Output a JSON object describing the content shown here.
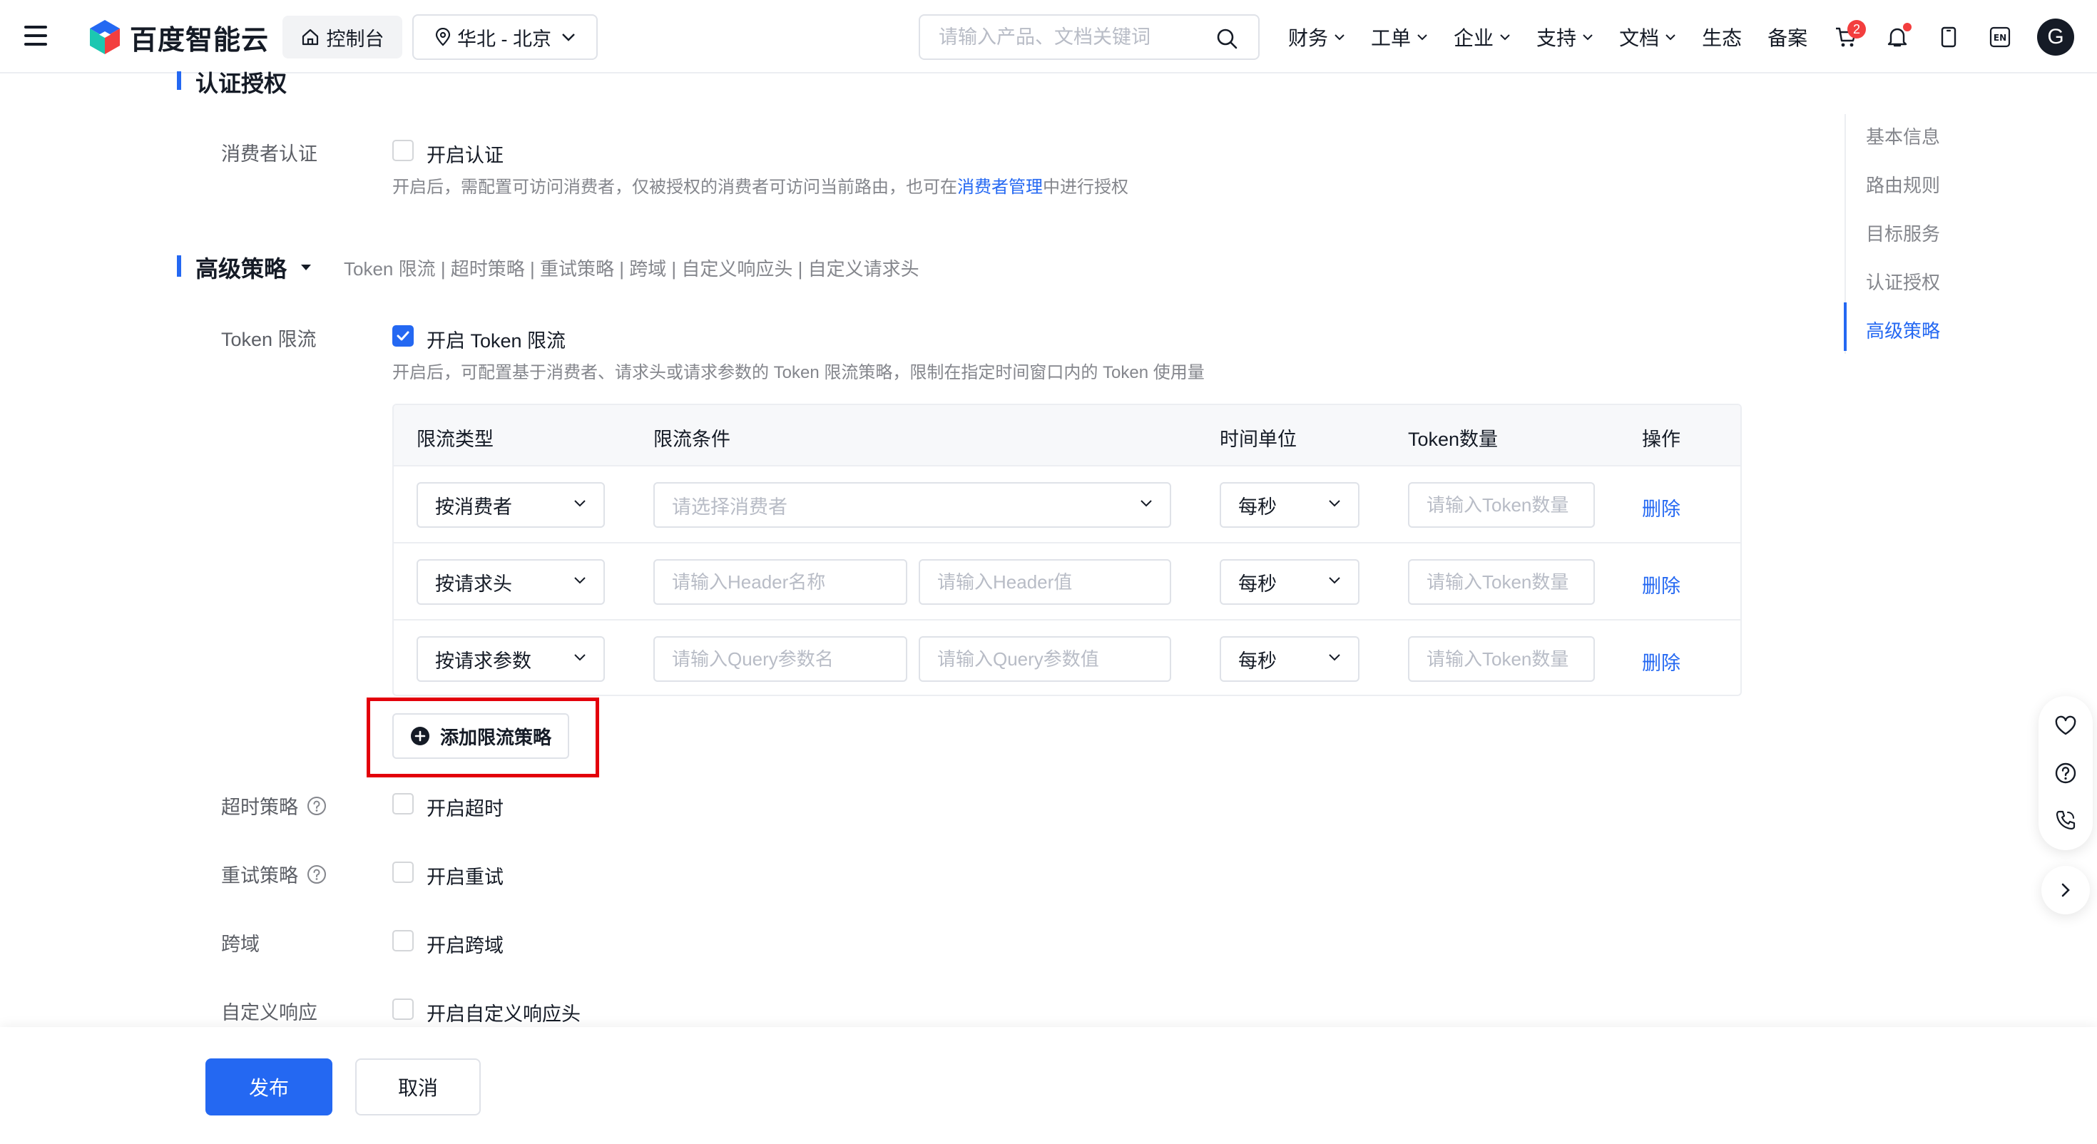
{
  "header": {
    "brand": "百度智能云",
    "console_label": "控制台",
    "region_label": "华北 - 北京",
    "search_placeholder": "请输入产品、文档关键词",
    "menu": [
      {
        "label": "财务",
        "has_dropdown": true
      },
      {
        "label": "工单",
        "has_dropdown": true
      },
      {
        "label": "企业",
        "has_dropdown": true
      },
      {
        "label": "支持",
        "has_dropdown": true
      },
      {
        "label": "文档",
        "has_dropdown": true
      },
      {
        "label": "生态",
        "has_dropdown": false
      },
      {
        "label": "备案",
        "has_dropdown": false
      }
    ],
    "cart_count": "2",
    "lang_label": "EN",
    "avatar_initial": "G"
  },
  "auth_section": {
    "title": "认证授权",
    "consumer_label": "消费者认证",
    "enable_label": "开启认证",
    "enable_checked": false,
    "help_prefix": "开启后，需配置可访问消费者，仅被授权的消费者可访问当前路由，也可在",
    "help_link": "消费者管理",
    "help_suffix": "中进行授权"
  },
  "advanced_section": {
    "title": "高级策略",
    "links": "Token 限流 | 超时策略 | 重试策略 | 跨域 | 自定义响应头 | 自定义请求头",
    "token_label": "Token 限流",
    "token_enable_label": "开启 Token 限流",
    "token_checked": true,
    "token_help": "开启后，可配置基于消费者、请求头或请求参数的 Token 限流策略，限制在指定时间窗口内的 Token 使用量",
    "table": {
      "headers": [
        "限流类型",
        "限流条件",
        "时间单位",
        "Token数量",
        "操作"
      ],
      "rows": [
        {
          "type": "按消费者",
          "cond_placeholder": "请选择消费者",
          "unit": "每秒",
          "token_placeholder": "请输入Token数量",
          "action": "删除"
        },
        {
          "type": "按请求头",
          "cond1_placeholder": "请输入Header名称",
          "cond2_placeholder": "请输入Header值",
          "unit": "每秒",
          "token_placeholder": "请输入Token数量",
          "action": "删除"
        },
        {
          "type": "按请求参数",
          "cond1_placeholder": "请输入Query参数名",
          "cond2_placeholder": "请输入Query参数值",
          "unit": "每秒",
          "token_placeholder": "请输入Token数量",
          "action": "删除"
        }
      ]
    },
    "add_button": "添加限流策略",
    "timeout_label": "超时策略",
    "timeout_enable": "开启超时",
    "retry_label": "重试策略",
    "retry_enable": "开启重试",
    "cors_label": "跨域",
    "cors_enable": "开启跨域",
    "custom_resp_label": "自定义响应",
    "custom_resp_enable": "开启自定义响应头"
  },
  "anchor_nav": {
    "items": [
      "基本信息",
      "路由规则",
      "目标服务",
      "认证授权",
      "高级策略"
    ],
    "active_index": 4
  },
  "footer": {
    "publish": "发布",
    "cancel": "取消"
  },
  "colors": {
    "primary": "#2468f2",
    "highlight_border": "#e3000b",
    "badge": "#f33e3e"
  }
}
